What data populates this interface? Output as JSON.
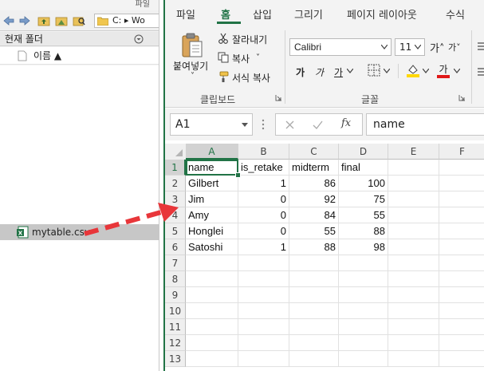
{
  "left_panel": {
    "title": "파일",
    "path": "C: ▸ Wo",
    "header": "현재 폴더",
    "column_name": "이름 ▲",
    "files": [
      "mytable.csv"
    ]
  },
  "excel": {
    "tabs": [
      "파일",
      "홈",
      "삽입",
      "그리기",
      "페이지 레이아웃",
      "수식"
    ],
    "active_tab": "홈",
    "clipboard": {
      "paste": "붙여넣기",
      "paste_arrow": "˅",
      "cut": "잘라내기",
      "copy": "복사",
      "copy_arrow": "˅",
      "format_painter": "서식 복사",
      "group_label": "클립보드"
    },
    "font": {
      "name": "Calibri",
      "size": "11",
      "grow": "가˄",
      "shrink": "가˅",
      "bold": "가",
      "italic": "가",
      "underline": "가",
      "group_label": "글꼴"
    },
    "name_box": "A1",
    "formula_value": "name",
    "fx": "fx",
    "columns": [
      "A",
      "B",
      "C",
      "D",
      "E",
      "F"
    ],
    "rows": [
      "1",
      "2",
      "3",
      "4",
      "5",
      "6",
      "7",
      "8",
      "9",
      "10",
      "11",
      "12",
      "13"
    ],
    "table": [
      [
        "name",
        "is_retake",
        "midterm",
        "final"
      ],
      [
        "Gilbert",
        "1",
        "86",
        "100"
      ],
      [
        "Jim",
        "0",
        "92",
        "75"
      ],
      [
        "Amy",
        "0",
        "84",
        "55"
      ],
      [
        "Honglei",
        "0",
        "55",
        "88"
      ],
      [
        "Satoshi",
        "1",
        "88",
        "98"
      ]
    ]
  },
  "colors": {
    "excel_green": "#217346",
    "arrow_red": "#e8363a",
    "fill_yellow": "#ffd800",
    "font_red": "#e01818"
  }
}
